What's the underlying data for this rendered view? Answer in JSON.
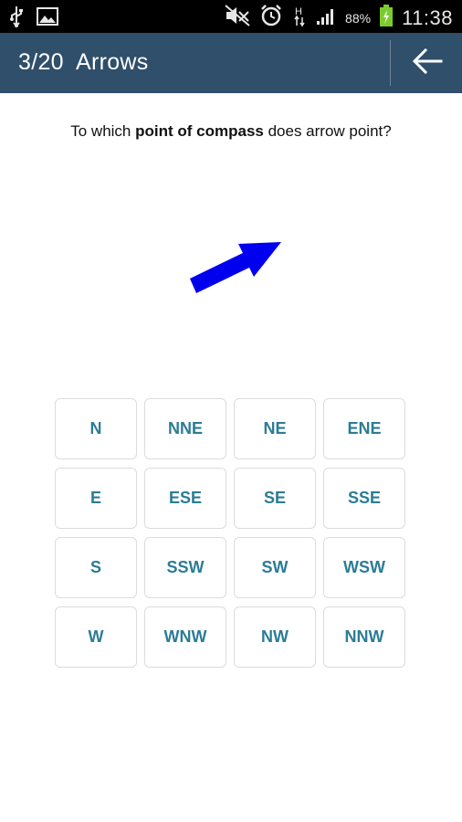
{
  "status_bar": {
    "icons_left": [
      "usb-icon",
      "image-icon"
    ],
    "icons_right": [
      "mute-icon",
      "alarm-icon",
      "hsdpa-icon",
      "signal-icon"
    ],
    "battery_percent": "88%",
    "time": "11:38"
  },
  "action_bar": {
    "title": "3/20  Arrows",
    "back_icon": "back-arrow-icon",
    "background_color": "#2f4f6b"
  },
  "question": {
    "prefix": "To which ",
    "emphasis": "point of compass",
    "suffix": " does arrow point?"
  },
  "arrow": {
    "icon": "arrow-icon",
    "color": "#0000ee",
    "direction": "ENE"
  },
  "options": [
    "N",
    "NNE",
    "NE",
    "ENE",
    "E",
    "ESE",
    "SE",
    "SSE",
    "S",
    "SSW",
    "SW",
    "WSW",
    "W",
    "WNW",
    "NW",
    "NNW"
  ],
  "accent_color": "#2b7c96"
}
